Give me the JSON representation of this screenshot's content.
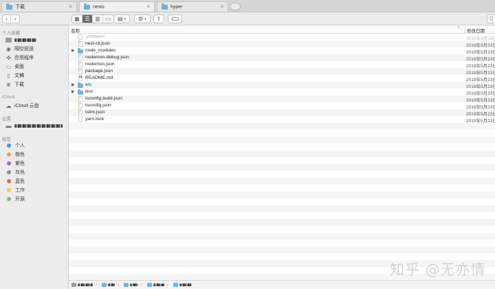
{
  "tabs": [
    {
      "label": "下载",
      "active": false
    },
    {
      "label": "nests",
      "active": true
    },
    {
      "label": "hyper",
      "active": false
    }
  ],
  "toolbar": {
    "back_icon": "chevron-left-icon",
    "forward_icon": "chevron-right-icon",
    "search_placeholder": "Q"
  },
  "sidebar": {
    "sections": [
      {
        "title": "个人收藏",
        "items": [
          {
            "label": "",
            "icon": "folder-icon",
            "redacted": true
          },
          {
            "label": "隔空投送",
            "icon": "airdrop-icon"
          },
          {
            "label": "应用程序",
            "icon": "applications-icon"
          },
          {
            "label": "桌面",
            "icon": "desktop-icon"
          },
          {
            "label": "文稿",
            "icon": "document-icon"
          },
          {
            "label": "下载",
            "icon": "download-icon"
          }
        ]
      },
      {
        "title": "iCloud",
        "items": [
          {
            "label": "iCloud 云盘",
            "icon": "cloud-icon"
          }
        ]
      },
      {
        "title": "位置",
        "items": [
          {
            "label": "",
            "icon": "laptop-icon",
            "redacted": true
          }
        ]
      },
      {
        "title": "标签",
        "items": [
          {
            "label": "个人",
            "color": "#4a90d9"
          },
          {
            "label": "橙色",
            "color": "#e8a341"
          },
          {
            "label": "紫色",
            "color": "#a06bc4"
          },
          {
            "label": "灰色",
            "color": "#8e8e8e"
          },
          {
            "label": "蓝色",
            "color": "#e06262"
          },
          {
            "label": "工作",
            "color": "#e9d14a"
          },
          {
            "label": "开源",
            "color": "#6cc36a"
          }
        ]
      }
    ]
  },
  "list": {
    "col_name": "名称",
    "col_date": "修改日期",
    "rows": [
      {
        "name": ".prettierrc",
        "type": "file",
        "expandable": false,
        "dim": true,
        "date": "2019年5月23日"
      },
      {
        "name": "nest-cli.json",
        "type": "json",
        "expandable": false,
        "date": "2019年5月23日"
      },
      {
        "name": "node_modules",
        "type": "folder",
        "expandable": true,
        "date": "2019年5月23日"
      },
      {
        "name": "nodemon-debug.json",
        "type": "json",
        "expandable": false,
        "date": "2019年5月23日"
      },
      {
        "name": "nodemon.json",
        "type": "json",
        "expandable": false,
        "date": "2019年5月23日"
      },
      {
        "name": "package.json",
        "type": "json",
        "expandable": false,
        "date": "2019年5月23日"
      },
      {
        "name": "README.md",
        "type": "md",
        "expandable": false,
        "date": "2019年5月23日"
      },
      {
        "name": "src",
        "type": "folder",
        "expandable": true,
        "date": "2019年5月23日"
      },
      {
        "name": "test",
        "type": "folder",
        "expandable": true,
        "date": "2019年5月23日"
      },
      {
        "name": "tsconfig.build.json",
        "type": "json",
        "expandable": false,
        "date": "2019年5月23日"
      },
      {
        "name": "tsconfig.json",
        "type": "json",
        "expandable": false,
        "date": "2019年5月23日"
      },
      {
        "name": "tslint.json",
        "type": "json",
        "expandable": false,
        "date": "2019年5月23日"
      },
      {
        "name": "yarn.lock",
        "type": "file",
        "expandable": false,
        "date": "2019年5月23日"
      }
    ]
  },
  "watermark": "知乎 @无亦情"
}
